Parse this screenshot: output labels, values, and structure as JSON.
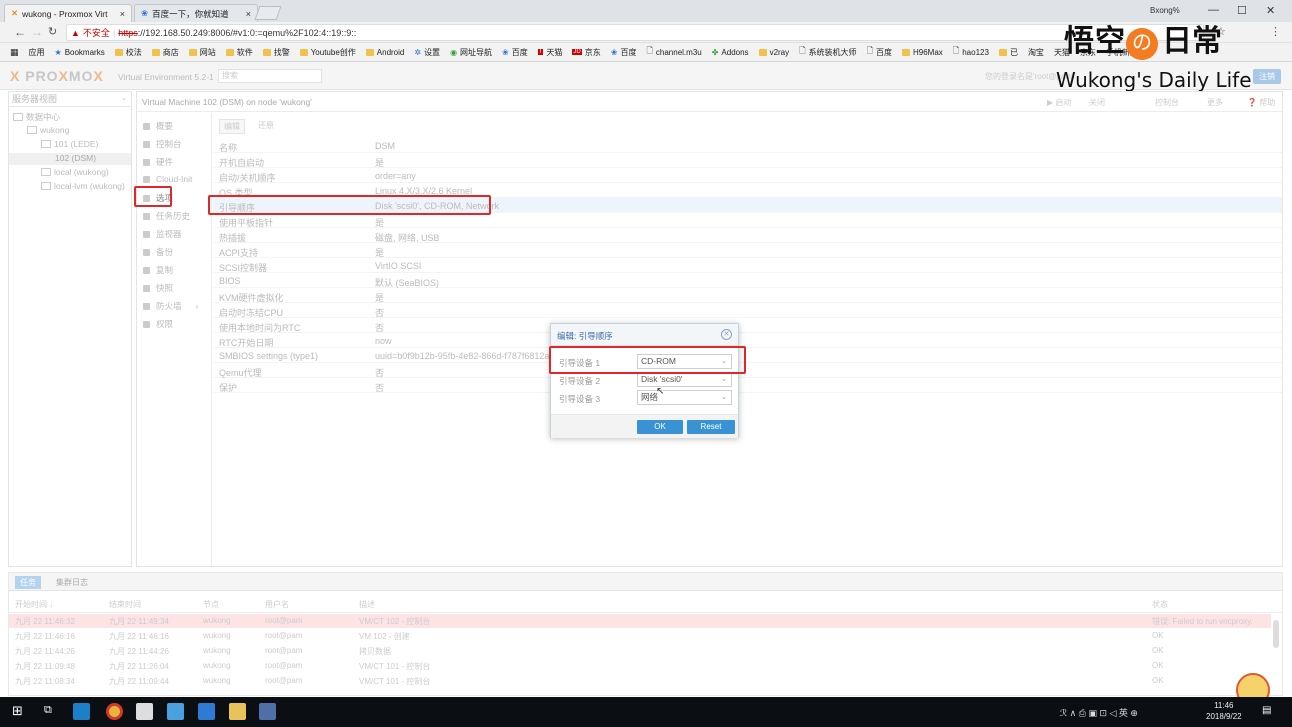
{
  "browser": {
    "tabs": [
      {
        "title": "wukong - Proxmox Virt",
        "close": "×"
      },
      {
        "title": "百度一下，你就知道",
        "close": "×"
      }
    ],
    "window_user": "Bxong%",
    "insecure_label": "不安全",
    "url_scheme": "https",
    "url_rest": "://192.168.50.249:8006/#v1:0:=qemu%2F102:4::19::9::",
    "bookmarks": [
      "应用",
      "Bookmarks",
      "校法",
      "商店",
      "网站",
      "软件",
      "找警",
      "Youtube创作",
      "Android",
      "设置",
      "网址导航",
      "百度",
      "天猫",
      "京东",
      "百度",
      "channel.m3u",
      "Addons",
      "v2ray",
      "系统装机大师",
      "百度",
      "H96Max",
      "hao123",
      "已",
      "淘宝",
      "天猫",
      "京东",
      "手机新闻"
    ]
  },
  "watermark": {
    "title": "悟空",
    "circle": "の",
    "tail": "日常",
    "subtitle": "Wukong's Daily Life"
  },
  "pve": {
    "logo_a": "PRO",
    "logo_x": "X",
    "logo_b": "MO",
    "logo_x2": "X",
    "version": "Virtual Environment 5.2-1",
    "search_placeholder": "搜索",
    "user_info": "您的登录名是'root@pam'",
    "create_button": "注销"
  },
  "tree": {
    "view_selector": "服务器视图",
    "items": [
      "数据中心",
      "wukong",
      "101 (LEDE)",
      "102 (DSM)",
      "local (wukong)",
      "local-lvm (wukong)"
    ]
  },
  "vm": {
    "title": "Virtual Machine 102 (DSM) on node 'wukong'",
    "actions": [
      "▶ 启动",
      "关闭",
      "控制台",
      "更多",
      "帮助"
    ]
  },
  "submenu": [
    "概要",
    "控制台",
    "硬件",
    "Cloud-Init",
    "选项",
    "任务历史",
    "监视器",
    "备份",
    "复制",
    "快照",
    "防火墙",
    "权限"
  ],
  "options": {
    "toolbar": [
      "编辑",
      "还原"
    ],
    "rows": [
      {
        "key": "名称",
        "value": "DSM"
      },
      {
        "key": "开机自启动",
        "value": "是"
      },
      {
        "key": "启动/关机顺序",
        "value": "order=any"
      },
      {
        "key": "OS 类型",
        "value": "Linux 4.X/3.X/2.6 Kernel"
      },
      {
        "key": "引导顺序",
        "value": "Disk 'scsi0', CD-ROM, Network"
      },
      {
        "key": "使用平板指针",
        "value": "是"
      },
      {
        "key": "热插拔",
        "value": "磁盘, 网络, USB"
      },
      {
        "key": "ACPI支持",
        "value": "是"
      },
      {
        "key": "SCSI控制器",
        "value": "VirtIO SCSI"
      },
      {
        "key": "BIOS",
        "value": "默认 (SeaBIOS)"
      },
      {
        "key": "KVM硬件虚拟化",
        "value": "是"
      },
      {
        "key": "启动时冻结CPU",
        "value": "否"
      },
      {
        "key": "使用本地时间为RTC",
        "value": "否"
      },
      {
        "key": "RTC开始日期",
        "value": "now"
      },
      {
        "key": "SMBIOS settings (type1)",
        "value": "uuid=b0f9b12b-95fb-4e82-866d-f787f6812a13"
      },
      {
        "key": "Qemu代理",
        "value": "否"
      },
      {
        "key": "保护",
        "value": "否"
      }
    ]
  },
  "dialog": {
    "title": "编辑: 引导顺序",
    "close_glyph": "⊗",
    "fields": [
      {
        "label": "引导设备 1",
        "value": "CD-ROM"
      },
      {
        "label": "引导设备 2",
        "value": "Disk 'scsi0'"
      },
      {
        "label": "引导设备 3",
        "value": "网络"
      }
    ],
    "ok": "OK",
    "reset": "Reset"
  },
  "log": {
    "tabs": [
      "任务",
      "集群日志"
    ],
    "headers": [
      "开始时间 ↓",
      "结束时间",
      "节点",
      "用户名",
      "描述",
      "状态"
    ],
    "rows": [
      {
        "start": "九月 22 11:46:32",
        "end": "九月 22 11:49:34",
        "node": "wukong",
        "user": "root@pam",
        "desc": "VM/CT 102 - 控制台",
        "status": "错误: Failed to run vncproxy."
      },
      {
        "start": "九月 22 11:46:16",
        "end": "九月 22 11:46:16",
        "node": "wukong",
        "user": "root@pam",
        "desc": "VM 102 - 创建",
        "status": "OK"
      },
      {
        "start": "九月 22 11:44:26",
        "end": "九月 22 11:44:26",
        "node": "wukong",
        "user": "root@pam",
        "desc": "拷贝数据",
        "status": "OK"
      },
      {
        "start": "九月 22 11:09:48",
        "end": "九月 22 11:26:04",
        "node": "wukong",
        "user": "root@pam",
        "desc": "VM/CT 101 - 控制台",
        "status": "OK"
      },
      {
        "start": "九月 22 11:08:34",
        "end": "九月 22 11:09:44",
        "node": "wukong",
        "user": "root@pam",
        "desc": "VM/CT 101 - 控制台",
        "status": "OK"
      }
    ]
  },
  "taskbar": {
    "tray": "ℛ ∧ ⎙ ▣ ⊡ ◁ 英 ⊕",
    "time": "11:46",
    "date": "2018/9/22"
  },
  "colors": {
    "accent": "#3892d4",
    "highlight": "#e0282a",
    "logo_orange": "#f47c20"
  }
}
